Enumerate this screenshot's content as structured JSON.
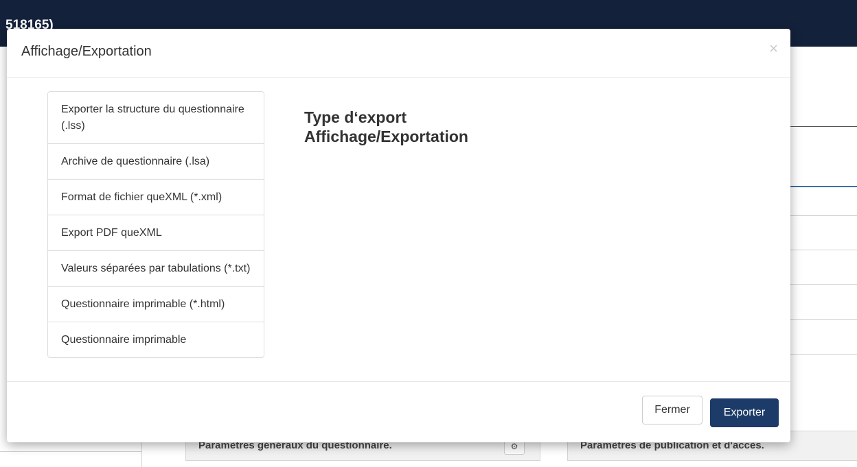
{
  "app": {
    "header_title": "518165)"
  },
  "background": {
    "left_panel_title": "Paramètres généraux du questionnaire.",
    "right_panel_title": "Paramètres de publication et d'accès."
  },
  "modal": {
    "title": "Affichage/Exportation",
    "close_symbol": "×",
    "heading_line1": "Type d‘export",
    "heading_line2": "Affichage/Exportation",
    "export_options": [
      "Exporter la structure du questionnaire (.lss)",
      "Archive de questionnaire (.lsa)",
      "Format de fichier queXML (*.xml)",
      "Export PDF queXML",
      "Valeurs séparées par tabulations (*.txt)",
      "Questionnaire imprimable (*.html)",
      "Questionnaire imprimable"
    ],
    "buttons": {
      "close_label": "Fermer",
      "export_label": "Exporter"
    }
  },
  "colors": {
    "topbar": "#13213a",
    "primary_button": "#1c3b68"
  }
}
